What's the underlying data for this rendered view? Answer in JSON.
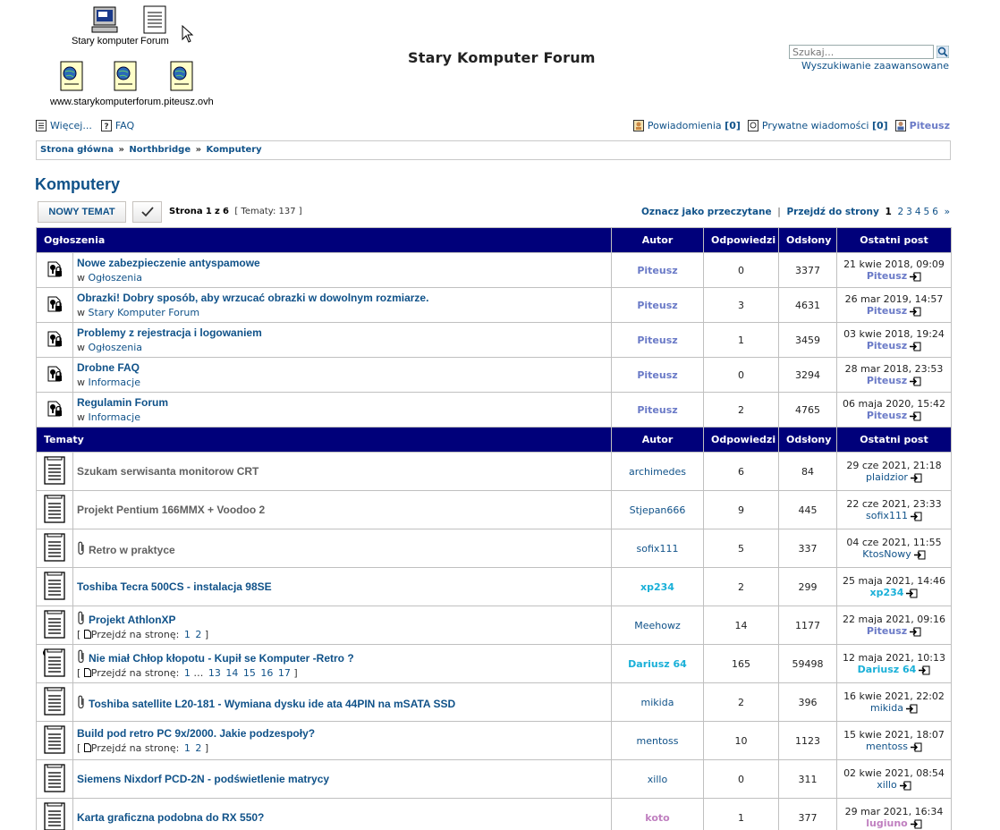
{
  "desktop": {
    "icon1_label": "Stary komputer",
    "icon2_label": "Forum",
    "url_label": "www.starykomputerforum.piteusz.ovh"
  },
  "header": {
    "site_title": "Stary Komputer Forum",
    "search_placeholder": "Szukaj...",
    "advanced_search": "Wyszukiwanie zaawansowane"
  },
  "toplinks": {
    "more": "Więcej...",
    "faq": "FAQ",
    "notifications": "Powiadomienia",
    "notifications_count": "[0]",
    "pm": "Prywatne wiadomości",
    "pm_count": "[0]",
    "user": "Piteusz"
  },
  "breadcrumb": {
    "home": "Strona główna",
    "level1": "Northbridge",
    "level2": "Komputery",
    "sep": "»"
  },
  "forum": {
    "title": "Komputery",
    "new_topic": "NOWY TEMAT",
    "page_prefix": "Strona",
    "page_current": "1",
    "page_of": "z",
    "page_total": "6",
    "topics_count": "[ Tematy: 137 ]",
    "mark_read": "Oznacz jako przeczytane",
    "goto_page": "Przejdź do strony",
    "pages": [
      "2",
      "3",
      "4",
      "5",
      "6"
    ],
    "next": "»",
    "pipe": "|"
  },
  "columns": {
    "announcements": "Ogłoszenia",
    "topics": "Tematy",
    "author": "Autor",
    "replies": "Odpowiedzi",
    "views": "Odsłony",
    "last_post": "Ostatni post"
  },
  "announcements": [
    {
      "title": "Nowe zabezpieczenie antyspamowe",
      "in": "w",
      "forum": "Ogłoszenia",
      "author": "Piteusz",
      "replies": "0",
      "views": "3377",
      "date": "21 kwie 2018, 09:09",
      "last_user": "Piteusz"
    },
    {
      "title": "Obrazki! Dobry sposób, aby wrzucać obrazki w dowolnym rozmiarze.",
      "in": "w",
      "forum": "Stary Komputer Forum",
      "author": "Piteusz",
      "replies": "3",
      "views": "4631",
      "date": "26 mar 2019, 14:57",
      "last_user": "Piteusz"
    },
    {
      "title": "Problemy z rejestracja i logowaniem",
      "in": "w",
      "forum": "Ogłoszenia",
      "author": "Piteusz",
      "replies": "1",
      "views": "3459",
      "date": "03 kwie 2018, 19:24",
      "last_user": "Piteusz"
    },
    {
      "title": "Drobne FAQ",
      "in": "w",
      "forum": "Informacje",
      "author": "Piteusz",
      "replies": "0",
      "views": "3294",
      "date": "28 mar 2018, 23:53",
      "last_user": "Piteusz"
    },
    {
      "title": "Regulamin Forum",
      "in": "w",
      "forum": "Informacje",
      "author": "Piteusz",
      "replies": "2",
      "views": "4765",
      "date": "06 maja 2020, 15:42",
      "last_user": "Piteusz"
    }
  ],
  "topics": [
    {
      "title": "Szukam serwisanta monitorow CRT",
      "author": "archimedes",
      "replies": "6",
      "views": "84",
      "date": "29 cze 2021, 21:18",
      "last_user": "plaidzior"
    },
    {
      "title": "Projekt Pentium 166MMX + Voodoo 2",
      "author": "Stjepan666",
      "replies": "9",
      "views": "445",
      "date": "22 cze 2021, 23:33",
      "last_user": "sofix111"
    },
    {
      "title": "Retro w praktyce",
      "author": "sofix111",
      "replies": "5",
      "views": "337",
      "date": "04 cze 2021, 11:55",
      "last_user": "KtosNowy"
    },
    {
      "title": "Toshiba Tecra 500CS - instalacja 98SE",
      "author": "xp234",
      "replies": "2",
      "views": "299",
      "date": "25 maja 2021, 14:46",
      "last_user": "xp234"
    },
    {
      "title": "Projekt AthlonXP",
      "author": "Meehowz",
      "replies": "14",
      "views": "1177",
      "date": "22 maja 2021, 09:16",
      "last_user": "Piteusz",
      "goto_label": "Przejdź na stronę:",
      "pages": [
        "1",
        "2"
      ]
    },
    {
      "title": "Nie miał Chłop kłopotu - Kupił se Komputer -Retro ?",
      "author": "Dariusz 64",
      "replies": "165",
      "views": "59498",
      "date": "12 maja 2021, 10:13",
      "last_user": "Dariusz 64",
      "goto_label": "Przejdź na stronę:",
      "pages": [
        "1",
        "…",
        "13",
        "14",
        "15",
        "16",
        "17"
      ]
    },
    {
      "title": "Toshiba satellite L20-181 - Wymiana dysku ide ata 44PIN na mSATA SSD",
      "author": "mikida",
      "replies": "2",
      "views": "396",
      "date": "16 kwie 2021, 22:02",
      "last_user": "mikida"
    },
    {
      "title": "Build pod retro PC 9x/2000. Jakie podzespoły?",
      "author": "mentoss",
      "replies": "10",
      "views": "1123",
      "date": "15 kwie 2021, 18:07",
      "last_user": "mentoss",
      "goto_label": "Przejdź na stronę:",
      "pages": [
        "1",
        "2"
      ]
    },
    {
      "title": "Siemens Nixdorf PCD-2N - podświetlenie matrycy",
      "author": "xillo",
      "replies": "0",
      "views": "311",
      "date": "02 kwie 2021, 08:54",
      "last_user": "xillo"
    },
    {
      "title": "Karta graficzna podobna do RX 550?",
      "author": "koto",
      "replies": "1",
      "views": "377",
      "date": "29 mar 2021, 16:34",
      "last_user": "lugiuno"
    }
  ],
  "colors": {
    "header_bg": "#00007a",
    "link": "#105289",
    "admin": "#6a7ac7",
    "moderator": "#1ab0d8"
  }
}
